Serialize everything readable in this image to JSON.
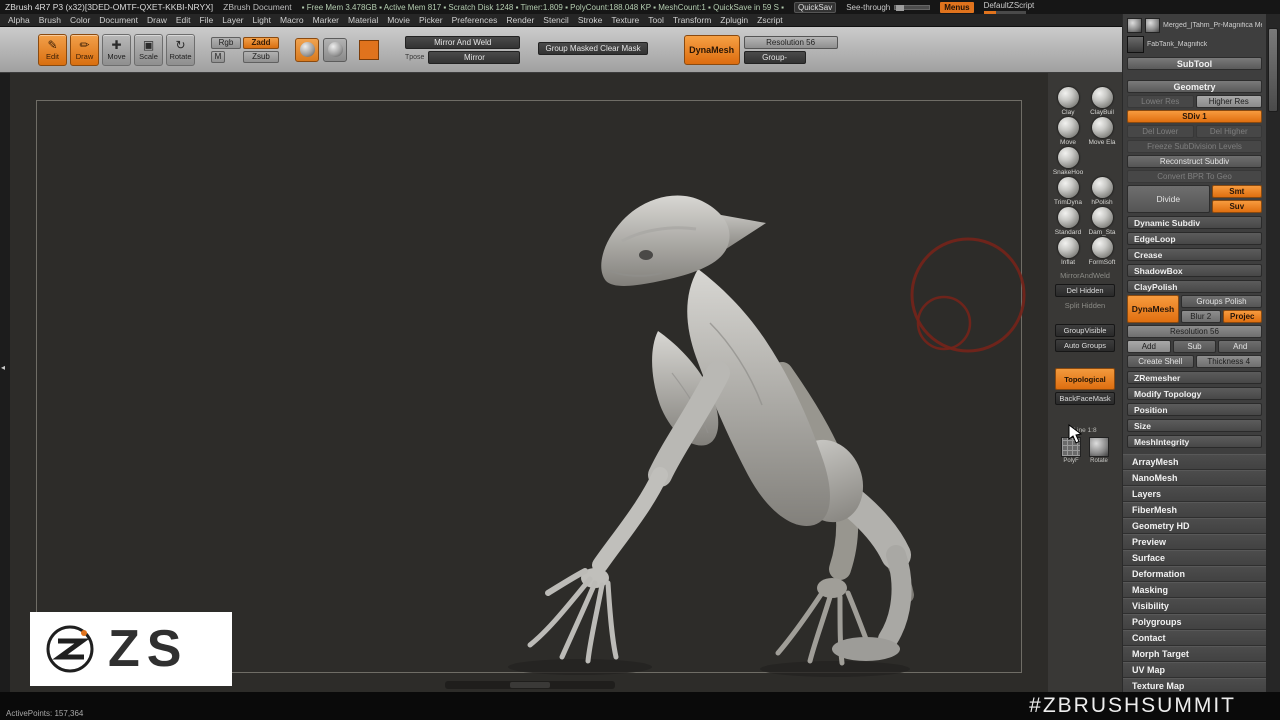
{
  "colors": {
    "accent_orange": "#e0731d",
    "annotation_red": "#76231a"
  },
  "icons": {
    "edit": "✎",
    "draw": "✏",
    "move": "✚",
    "scale": "▣",
    "rotate": "↻",
    "tray_collapse": "◂"
  },
  "title_bar": {
    "app_title": "ZBrush 4R7 P3 (x32)[3DED-OMTF-QXET-KKBI-NRYX]",
    "doc_title": "ZBrush Document",
    "stats": "▪ Free Mem 3.478GB ▪ Active Mem 817 ▪ Scratch Disk 1248 ▪ Timer:1.809 ▪ PolyCount:188.048 KP ▪ MeshCount:1 ▪ QuickSave in 59 S ▪",
    "quicksave": "QuickSav",
    "see_through": "See-through",
    "menus": "Menus",
    "default_zscript": "DefaultZScript"
  },
  "menu_bar": {
    "items": [
      "Alpha",
      "Brush",
      "Color",
      "Document",
      "Draw",
      "Edit",
      "File",
      "Layer",
      "Light",
      "Macro",
      "Marker",
      "Material",
      "Movie",
      "Picker",
      "Preferences",
      "Render",
      "Stencil",
      "Stroke",
      "Texture",
      "Tool",
      "Transform",
      "Zplugin",
      "Zscript"
    ]
  },
  "toolbar": {
    "edit": "Edit",
    "draw": "Draw",
    "move": "Move",
    "scale": "Scale",
    "rotate": "Rotate",
    "rgb": "Rgb",
    "m": "M",
    "zadd": "Zadd",
    "zsub": "Zsub",
    "mirror_and_weld": "Mirror And Weld",
    "tpose": "Tpose",
    "mirror": "Mirror",
    "group_masked": "Group Masked Clear Mask",
    "dynamesh": "DynaMesh",
    "resolution": "Resolution 56",
    "group_minus": "Group-"
  },
  "right_shelf": {
    "brushes": [
      {
        "label": "Clay"
      },
      {
        "label": "ClayBuil"
      },
      {
        "label": "Move"
      },
      {
        "label": "Move Ela"
      },
      {
        "label": "SnakeHoo"
      },
      {
        "label": ""
      },
      {
        "label": "TrimDyna"
      },
      {
        "label": "hPolish"
      },
      {
        "label": "Standard"
      },
      {
        "label": "Dam_Sta"
      },
      {
        "label": "Inflat"
      },
      {
        "label": "FormSoft"
      }
    ],
    "buttons": {
      "mirror_weld": "MirrorAndWeld",
      "del_hidden": "Del Hidden",
      "split_hidden": "Split Hidden",
      "group_visible": "GroupVisible",
      "auto_groups": "Auto Groups",
      "topological": "Topological",
      "backface_mask": "BackFaceMask",
      "line_label": "Line 1:8",
      "polyf": "PolyF",
      "rotate": "Rotate"
    }
  },
  "tool_palette": {
    "thumb_caption_1": "Merged_|Tahm_Pr-Magnifica Merged_|",
    "thumb_caption_2": "FabTank_Magnifick",
    "subtool_header": "SubTool",
    "geometry_header": "Geometry",
    "lower_res": "Lower Res",
    "higher_res": "Higher Res",
    "sdiv": "SDiv 1",
    "del_lower": "Del Lower",
    "del_higher": "Del Higher",
    "freeze": "Freeze SubDivision Levels",
    "reconstruct": "Reconstruct Subdiv",
    "convert_bpr": "Convert BPR To Geo",
    "divide": "Divide",
    "smt": "Smt",
    "suv": "Suv",
    "subsections_a": [
      "Dynamic Subdiv",
      "EdgeLoop",
      "Crease",
      "ShadowBox",
      "ClayPolish"
    ],
    "dynamesh": {
      "button": "DynaMesh",
      "groups_polish": "Groups Polish",
      "blur": "Blur 2",
      "project": "Projec",
      "resolution": "Resolution 56",
      "add": "Add",
      "sub": "Sub",
      "and": "And",
      "create_shell": "Create Shell",
      "thickness": "Thickness 4"
    },
    "subsections_b": [
      "ZRemesher",
      "Modify Topology",
      "Position",
      "Size",
      "MeshIntegrity"
    ],
    "sections": [
      "ArrayMesh",
      "NanoMesh",
      "Layers",
      "FiberMesh",
      "Geometry HD",
      "Preview",
      "Surface",
      "Deformation",
      "Masking",
      "Visibility",
      "Polygroups",
      "Contact",
      "Morph Target",
      "UV Map",
      "Texture Map"
    ]
  },
  "status_bar": {
    "active_points": "ActivePoints: 157,364",
    "hashtag": "#ZBRUSHSUMMIT"
  },
  "logo": {
    "text": "ZS"
  }
}
